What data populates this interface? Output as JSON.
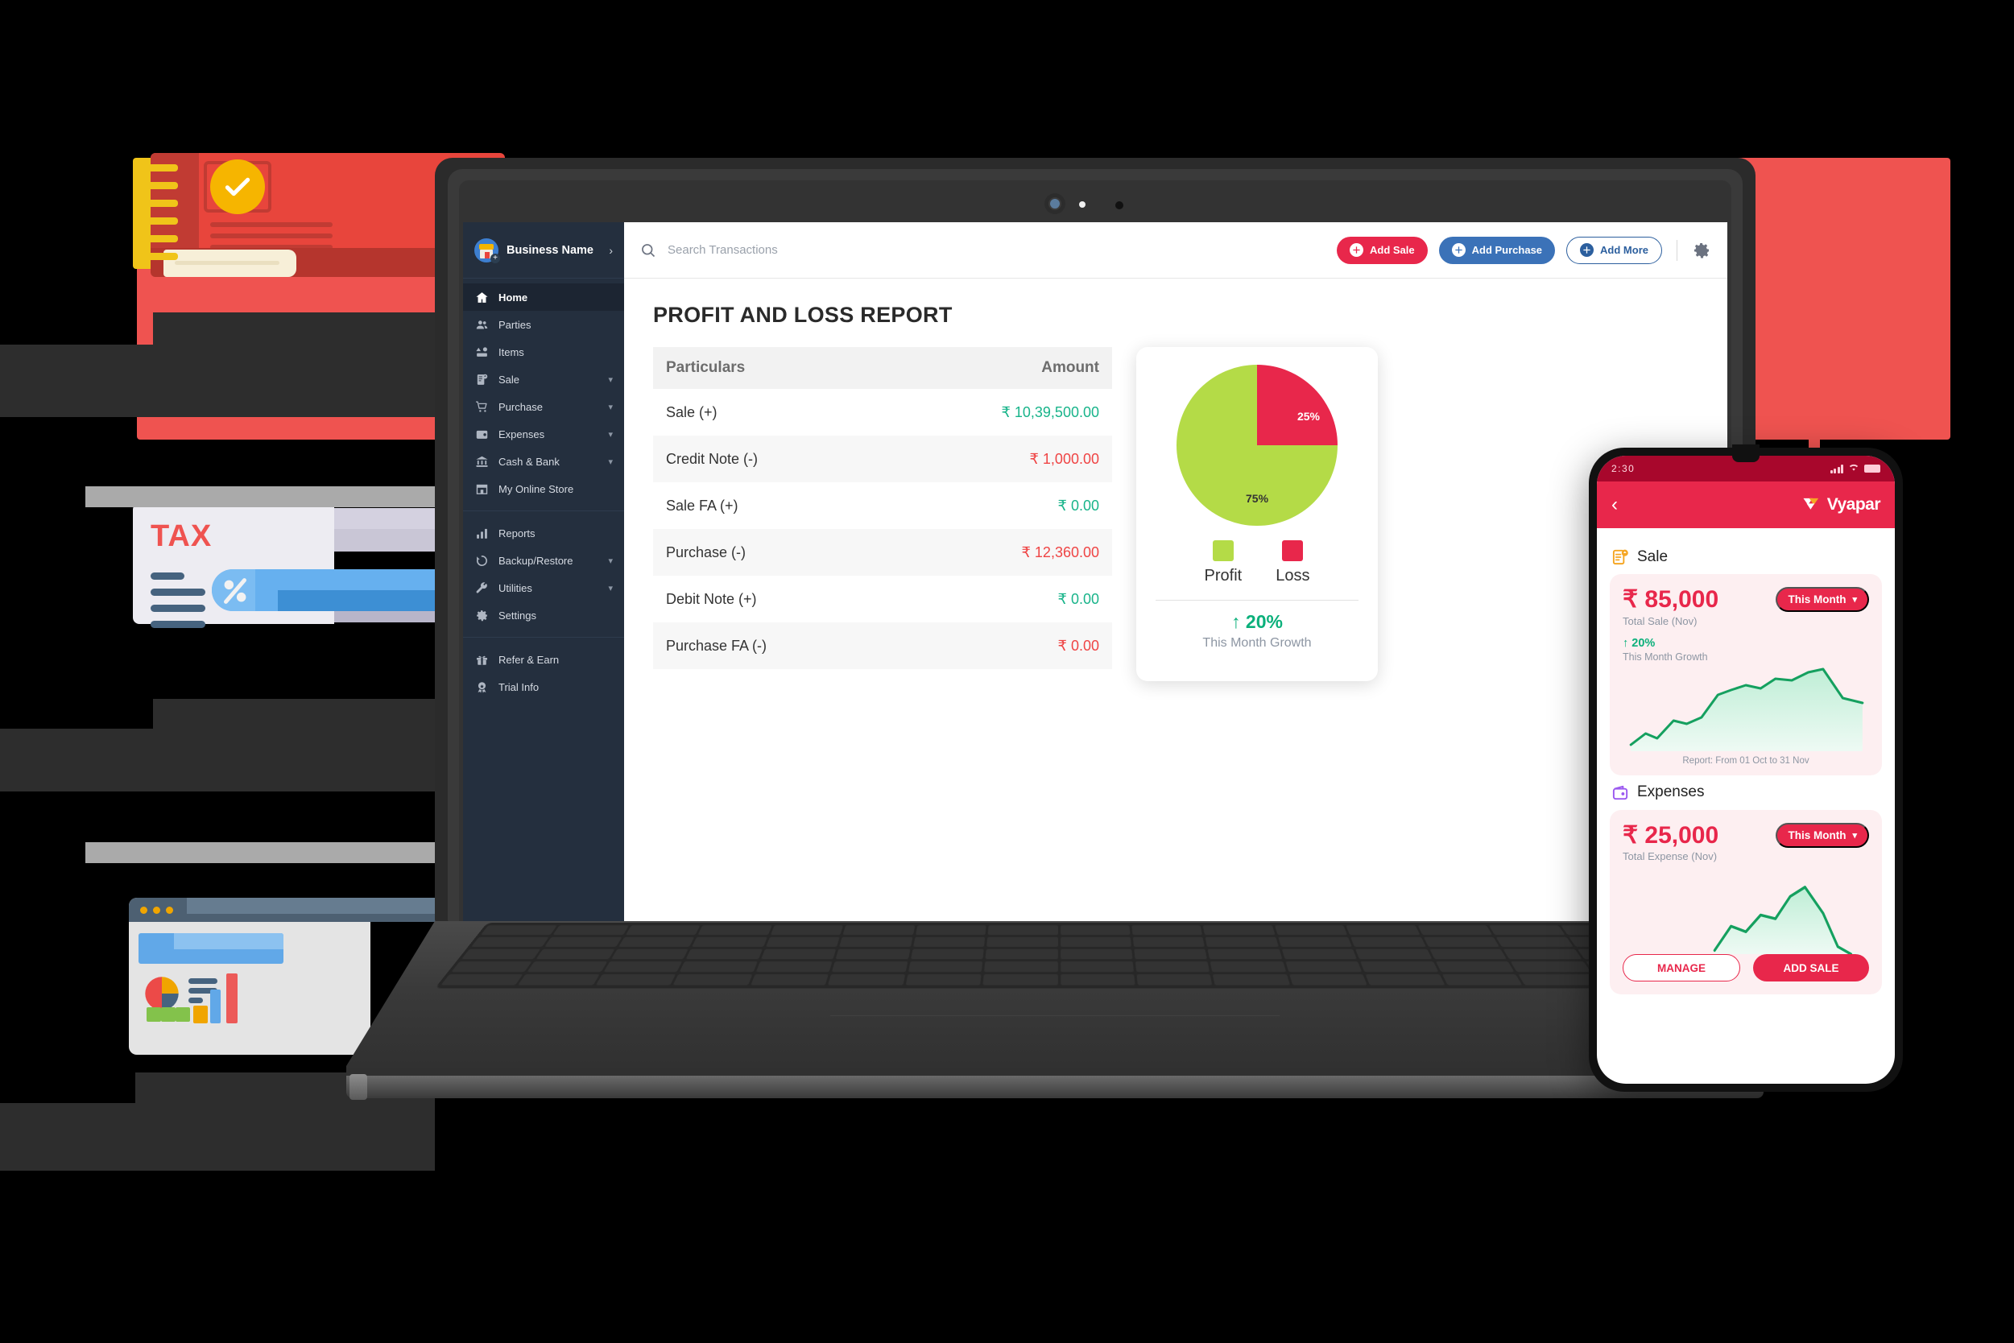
{
  "desktop": {
    "sidebar": {
      "business_name": "Business Name",
      "chevron": "›",
      "groups": [
        {
          "items": [
            {
              "label": "Home",
              "icon": "home-icon",
              "active": true,
              "expandable": false
            },
            {
              "label": "Parties",
              "icon": "parties-icon",
              "active": false,
              "expandable": false
            },
            {
              "label": "Items",
              "icon": "items-icon",
              "active": false,
              "expandable": false
            },
            {
              "label": "Sale",
              "icon": "sale-icon",
              "active": false,
              "expandable": true
            },
            {
              "label": "Purchase",
              "icon": "cart-icon",
              "active": false,
              "expandable": true
            },
            {
              "label": "Expenses",
              "icon": "wallet-icon",
              "active": false,
              "expandable": true
            },
            {
              "label": "Cash & Bank",
              "icon": "bank-icon",
              "active": false,
              "expandable": true
            },
            {
              "label": "My Online Store",
              "icon": "store-icon",
              "active": false,
              "expandable": false
            }
          ]
        },
        {
          "items": [
            {
              "label": "Reports",
              "icon": "bar-chart-icon",
              "active": false,
              "expandable": false
            },
            {
              "label": "Backup/Restore",
              "icon": "restore-icon",
              "active": false,
              "expandable": true
            },
            {
              "label": "Utilities",
              "icon": "wrench-icon",
              "active": false,
              "expandable": true
            },
            {
              "label": "Settings",
              "icon": "gear-icon",
              "active": false,
              "expandable": false
            }
          ]
        },
        {
          "items": [
            {
              "label": "Refer & Earn",
              "icon": "gift-icon",
              "active": false,
              "expandable": false
            },
            {
              "label": "Trial Info",
              "icon": "badge-icon",
              "active": false,
              "expandable": false
            }
          ]
        }
      ]
    },
    "topbar": {
      "search_placeholder": "Search Transactions",
      "search_value": "",
      "add_sale": "Add Sale",
      "add_purchase": "Add Purchase",
      "add_more": "Add More",
      "settings_icon": "gear-icon"
    },
    "report": {
      "title": "PROFIT AND LOSS REPORT",
      "columns": [
        "Particulars",
        "Amount"
      ],
      "rows": [
        {
          "particular": "Sale (+)",
          "amount": "₹ 10,39,500.00",
          "sign": "pos"
        },
        {
          "particular": "Credit Note (-)",
          "amount": "₹ 1,000.00",
          "sign": "neg"
        },
        {
          "particular": "Sale FA (+)",
          "amount": "₹ 0.00",
          "sign": "pos"
        },
        {
          "particular": "Purchase (-)",
          "amount": "₹ 12,360.00",
          "sign": "neg"
        },
        {
          "particular": "Debit Note (+)",
          "amount": "₹ 0.00",
          "sign": "pos"
        },
        {
          "particular": "Purchase FA (-)",
          "amount": "₹ 0.00",
          "sign": "neg"
        }
      ]
    },
    "pie_card": {
      "label_profit": "75%",
      "label_loss": "25%",
      "legend": [
        {
          "name": "Profit",
          "color": "#b4db47"
        },
        {
          "name": "Loss",
          "color": "#e8274b"
        }
      ],
      "growth_value": "↑ 20%",
      "growth_label": "This Month Growth"
    }
  },
  "phone": {
    "status": {
      "time": "2:30",
      "signal_icon": "signal-icon",
      "wifi_icon": "wifi-icon",
      "battery_icon": "battery-icon"
    },
    "appbar": {
      "back_icon": "back-chevron-icon",
      "brand": "Vyapar",
      "brand_mark": "vyapar-logo-icon"
    },
    "sections": [
      {
        "icon": "sale-doc-icon",
        "title": "Sale",
        "amount": "₹ 85,000",
        "amount_label": "Total Sale (Nov)",
        "chip": "This Month",
        "chip_caret": "▾",
        "growth_value": "↑ 20%",
        "growth_label": "This Month Growth",
        "report": "Report: From 01 Oct to 31 Nov"
      },
      {
        "icon": "expense-wallet-icon",
        "title": "Expenses",
        "amount": "₹ 25,000",
        "amount_label": "Total Expense (Nov)",
        "chip": "This Month",
        "chip_caret": "▾",
        "growth_value": "",
        "growth_label": "",
        "report": ""
      }
    ],
    "actions": {
      "manage": "MANAGE",
      "add_sale": "ADD SALE"
    }
  },
  "illustrations": {
    "tax_label": "TAX",
    "book": "ledger-book-illustration",
    "tax": "tax-invoice-illustration",
    "dashboard": "dashboard-window-illustration"
  },
  "chart_data": [
    {
      "type": "pie",
      "title": "Profit / Loss split",
      "labels": [
        "Profit",
        "Loss"
      ],
      "values": [
        75,
        25
      ],
      "colors": [
        "#b4db47",
        "#e8274b"
      ],
      "legend_position": "bottom",
      "annotations": [
        "75%",
        "25%",
        "↑ 20% This Month Growth"
      ]
    },
    {
      "type": "table",
      "title": "PROFIT AND LOSS REPORT",
      "columns": [
        "Particulars",
        "Amount"
      ],
      "rows": [
        [
          "Sale (+)",
          "₹ 10,39,500.00"
        ],
        [
          "Credit Note (-)",
          "₹ 1,000.00"
        ],
        [
          "Sale FA (+)",
          "₹ 0.00"
        ],
        [
          "Purchase (-)",
          "₹ 12,360.00"
        ],
        [
          "Debit Note (+)",
          "₹ 0.00"
        ],
        [
          "Purchase FA (-)",
          "₹ 0.00"
        ]
      ]
    },
    {
      "type": "area",
      "title": "Total Sale (Nov) trend",
      "xlabel": "Report: From 01 Oct to 31 Nov",
      "ylabel": "",
      "x": [
        0,
        1,
        2,
        3,
        4,
        5,
        6,
        7,
        8,
        9,
        10,
        11,
        12,
        13,
        14,
        15
      ],
      "values": [
        6,
        14,
        10,
        22,
        20,
        24,
        44,
        52,
        58,
        56,
        70,
        68,
        86,
        96,
        62,
        56
      ],
      "line_color": "#15a05f",
      "fill_color": "#cdf0dd",
      "grid": false
    },
    {
      "type": "area",
      "title": "Total Expense (Nov) trend",
      "xlabel": "",
      "ylabel": "",
      "x": [
        0,
        1,
        2,
        3,
        4,
        5,
        6,
        7,
        8,
        9,
        10,
        11
      ],
      "values": [
        4,
        8,
        16,
        34,
        40,
        52,
        48,
        60,
        56,
        78,
        88,
        50
      ],
      "line_color": "#15a05f",
      "fill_color": "#cdf0dd",
      "grid": false
    }
  ]
}
